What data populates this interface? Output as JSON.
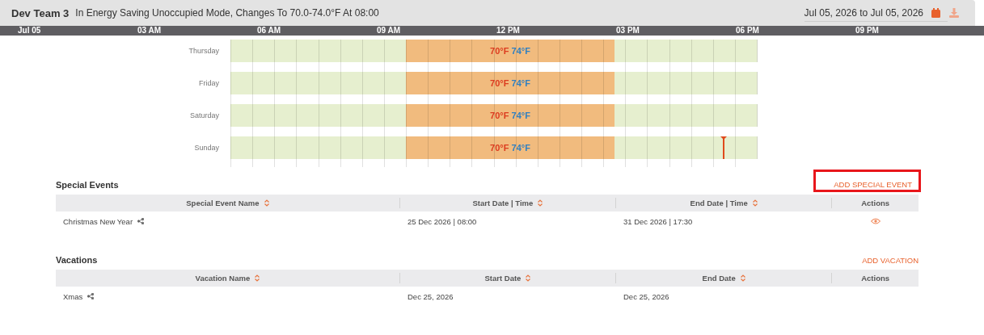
{
  "header": {
    "title": "Dev Team 3",
    "status": "In Energy Saving Unoccupied Mode, Changes To 70.0-74.0°F At 08:00",
    "date_range": "Jul 05, 2026 to Jul 05, 2026"
  },
  "timeline": [
    "Jul 05",
    "03 AM",
    "06 AM",
    "09 AM",
    "12 PM",
    "03 PM",
    "06 PM",
    "09 PM"
  ],
  "schedule": [
    {
      "day": "Thursday",
      "heat": "70°F",
      "cool": "74°F",
      "now_marker": false
    },
    {
      "day": "Friday",
      "heat": "70°F",
      "cool": "74°F",
      "now_marker": false
    },
    {
      "day": "Saturday",
      "heat": "70°F",
      "cool": "74°F",
      "now_marker": false
    },
    {
      "day": "Sunday",
      "heat": "70°F",
      "cool": "74°F",
      "now_marker": true
    }
  ],
  "special_events": {
    "title": "Special Events",
    "add_link": "ADD SPECIAL EVENT",
    "highlighted": true,
    "columns": [
      {
        "label": "Special Event Name",
        "sortable": true
      },
      {
        "label": "Start Date | Time",
        "sortable": true
      },
      {
        "label": "End Date | Time",
        "sortable": true
      },
      {
        "label": "Actions",
        "sortable": false
      }
    ],
    "rows": [
      {
        "name": "Christmas New Year",
        "start": "25 Dec 2026 | 08:00",
        "end": "31 Dec 2026 | 17:30",
        "viewable": true
      }
    ]
  },
  "vacations": {
    "title": "Vacations",
    "add_link": "ADD VACATION",
    "highlighted": false,
    "columns": [
      {
        "label": "Vacation Name",
        "sortable": true
      },
      {
        "label": "Start Date",
        "sortable": true
      },
      {
        "label": "End Date",
        "sortable": true
      },
      {
        "label": "Actions",
        "sortable": false
      }
    ],
    "rows": [
      {
        "name": "Xmas",
        "start": "Dec 25, 2026",
        "end": "Dec 25, 2026",
        "viewable": false
      }
    ]
  }
}
